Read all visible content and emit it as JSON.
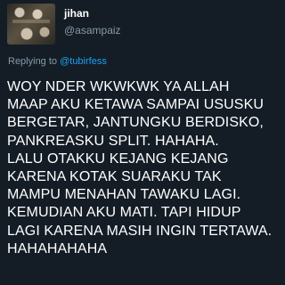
{
  "author": {
    "display_name": "jihan",
    "handle": "@asampaiz",
    "avatar_icon": "profile-photo"
  },
  "reply": {
    "prefix": "Replying to ",
    "mention": "@tubirfess"
  },
  "tweet_lines": [
    "WOY NDER WKWKWK YA ALLAH",
    "MAAP AKU KETAWA SAMPAI USUSKU",
    "BERGETAR, JANTUNGKU BERDISKO,",
    "PANKREASKU SPLIT. HAHAHA.",
    "LALU OTAKKU KEJANG KEJANG",
    "KARENA KOTAK SUARAKU TAK",
    "MAMPU MENAHAN TAWAKU LAGI.",
    "KEMUDIAN AKU MATI. TAPI HIDUP",
    "LAGI KARENA MASIH INGIN TERTAWA.",
    "HAHAHAHAHA"
  ],
  "colors": {
    "background": "#141d26",
    "text": "#ffffff",
    "muted": "#8899a6",
    "link": "#1da1f2"
  }
}
